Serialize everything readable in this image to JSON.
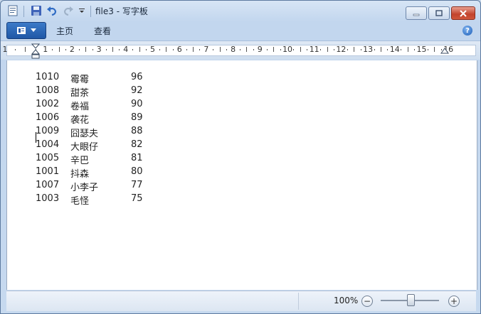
{
  "window": {
    "title": "file3 - 写字板"
  },
  "ribbon": {
    "file_menu_icon": "file-menu-icon",
    "tabs": [
      "主页",
      "查看"
    ],
    "help_label": "?"
  },
  "ruler": {
    "marks": [
      "1",
      "1",
      "2",
      "3",
      "4",
      "5",
      "6",
      "7",
      "8",
      "9",
      "10",
      "11",
      "12",
      "13",
      "14",
      "15",
      "16"
    ]
  },
  "document": {
    "rows": [
      {
        "id": "1010",
        "name": "霉霉",
        "score": "96"
      },
      {
        "id": "1008",
        "name": "甜茶",
        "score": "92"
      },
      {
        "id": "1002",
        "name": "卷福",
        "score": "90"
      },
      {
        "id": "1006",
        "name": "袭花",
        "score": "89"
      },
      {
        "id": "1009",
        "name": "囧瑟夫",
        "score": "88"
      },
      {
        "id": "1004",
        "name": "大眼仔",
        "score": "82"
      },
      {
        "id": "1005",
        "name": "辛巴",
        "score": "81"
      },
      {
        "id": "1001",
        "name": "抖森",
        "score": "80"
      },
      {
        "id": "1007",
        "name": "小李子",
        "score": "77"
      },
      {
        "id": "1003",
        "name": "毛怪",
        "score": "75"
      }
    ]
  },
  "status": {
    "zoom": "100%",
    "zoom_out": "−",
    "zoom_in": "+",
    "zoom_level": 1.0
  }
}
